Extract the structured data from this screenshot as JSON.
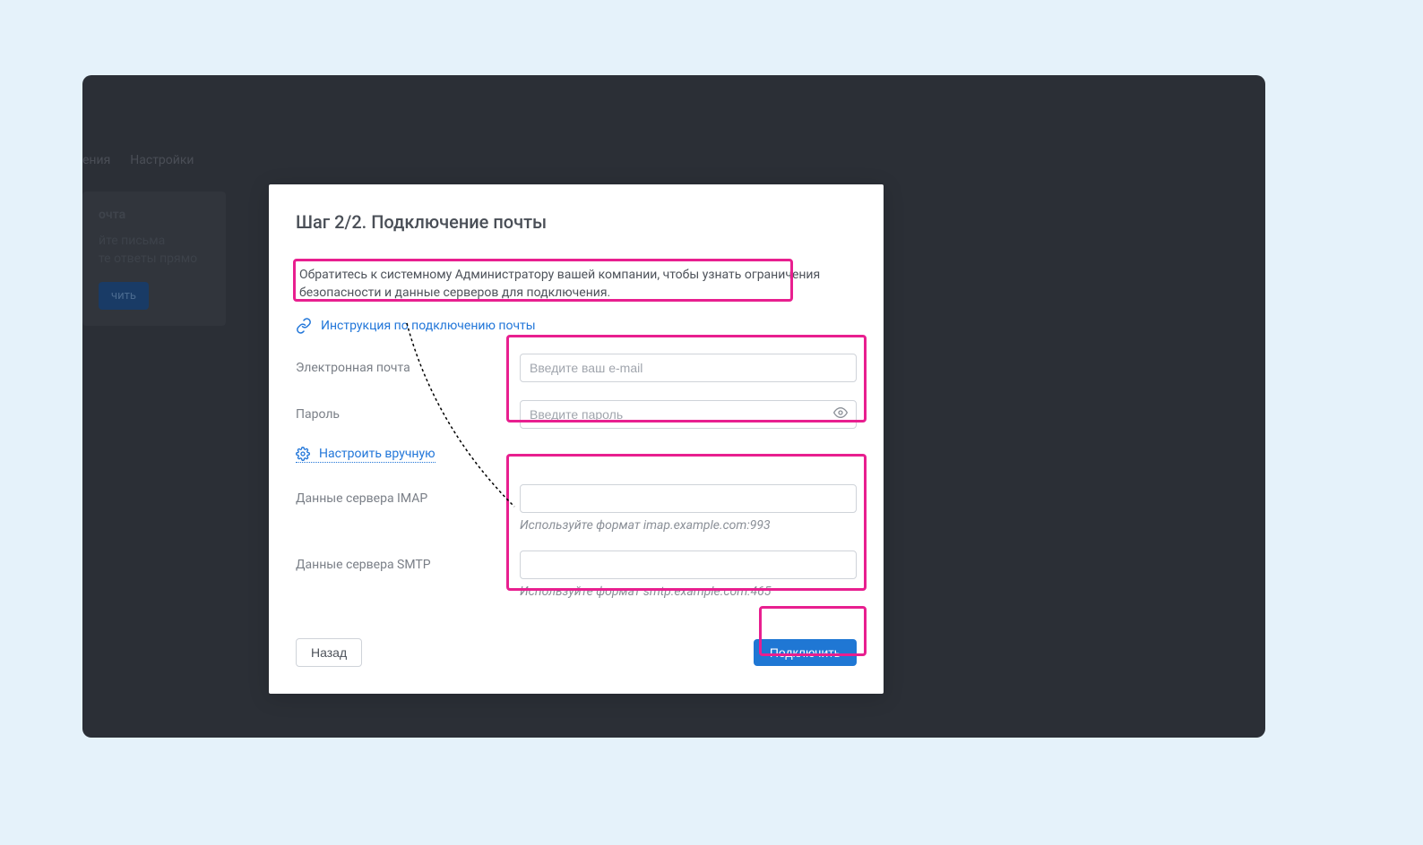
{
  "bg": {
    "nav1": "ения",
    "nav2": "Настройки",
    "card_title": "очта",
    "card_l1": "йте письма",
    "card_l2": "те ответы прямо",
    "card_btn": "чить"
  },
  "modal": {
    "title": "Шаг 2/2. Подключение почты",
    "info": "Обратитесь к системному Администратору вашей компании, чтобы узнать ограничения безопасности и данные серверов для подключения.",
    "instruction_link": "Инструкция по подключению почты",
    "email_label": "Электронная почта",
    "email_placeholder": "Введите ваш e-mail",
    "password_label": "Пароль",
    "password_placeholder": "Введите пароль",
    "manual_link": "Настроить вручную",
    "imap_label": "Данные сервера IMAP",
    "imap_hint": "Используйте формат imap.example.com:993",
    "smtp_label": "Данные сервера SMTP",
    "smtp_hint": "Используйте формат smtp.example.com:465",
    "back": "Назад",
    "connect": "Подключить"
  }
}
